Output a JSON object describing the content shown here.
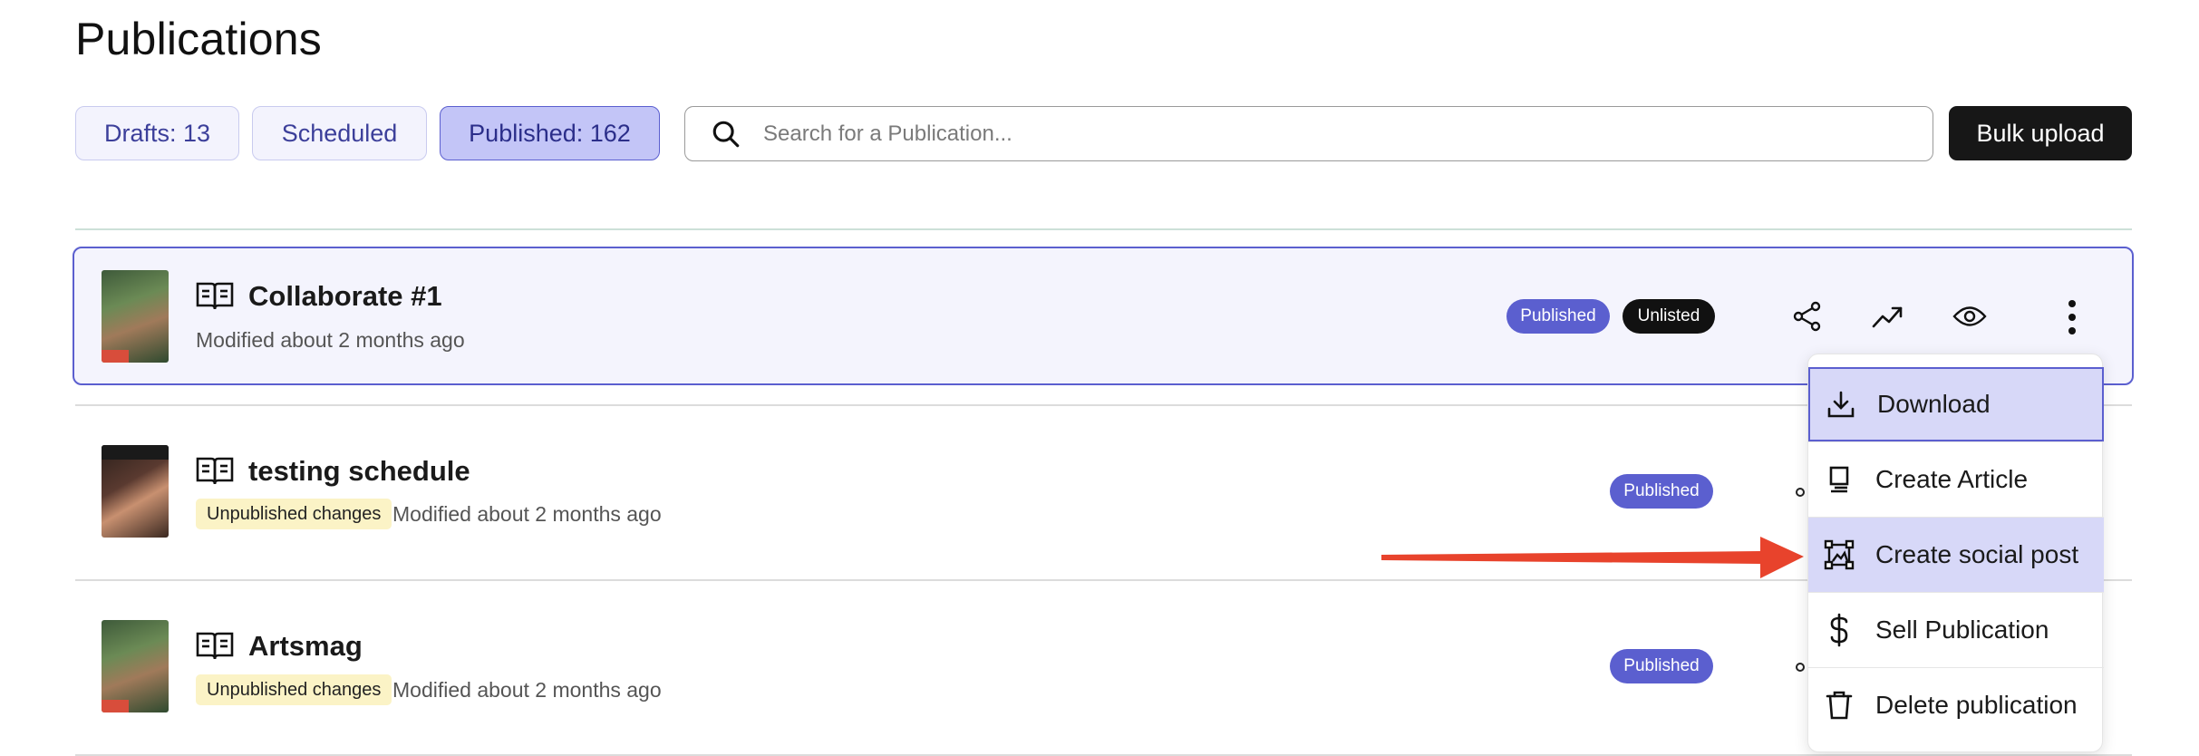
{
  "page": {
    "title": "Publications"
  },
  "filters": {
    "drafts": "Drafts: 13",
    "scheduled": "Scheduled",
    "published": "Published: 162"
  },
  "search": {
    "placeholder": "Search for a Publication...",
    "value": ""
  },
  "bulk_upload": {
    "label": "Bulk upload"
  },
  "publications": [
    {
      "title": "Collaborate #1",
      "modified": "Modified about 2 months ago",
      "badges": [
        "Published",
        "Unlisted"
      ],
      "unpublished_changes": ""
    },
    {
      "title": "testing schedule",
      "modified": "Modified about 2 months ago",
      "badges": [
        "Published"
      ],
      "unpublished_changes": "Unpublished changes"
    },
    {
      "title": "Artsmag",
      "modified": "Modified about 2 months ago",
      "badges": [
        "Published"
      ],
      "unpublished_changes": "Unpublished changes"
    }
  ],
  "menu": {
    "items": [
      {
        "label": "Download",
        "icon": "download-icon"
      },
      {
        "label": "Create Article",
        "icon": "article-icon"
      },
      {
        "label": "Create social post",
        "icon": "image-frame-icon"
      },
      {
        "label": "Sell Publication",
        "icon": "dollar-icon"
      },
      {
        "label": "Delete publication",
        "icon": "trash-icon"
      }
    ]
  },
  "colors": {
    "accent": "#5b5fcf",
    "arrow": "#e8432c",
    "unpublished_badge": "#fbf3c6"
  }
}
